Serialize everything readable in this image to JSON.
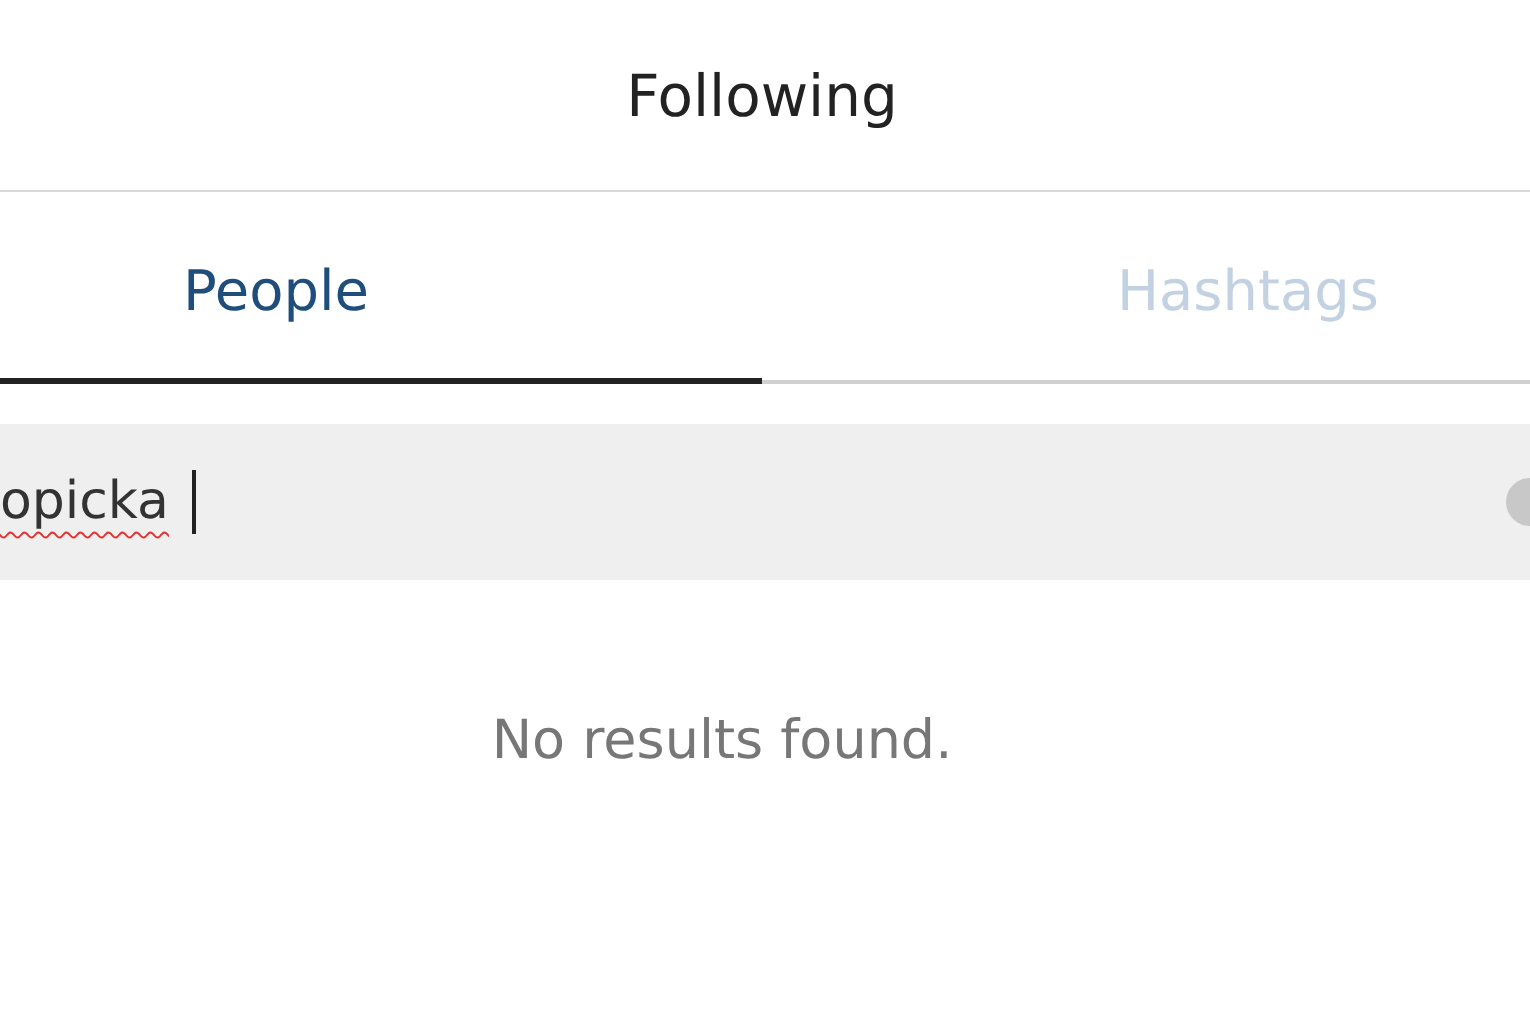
{
  "header": {
    "title": "Following"
  },
  "tabs": [
    {
      "label": "People",
      "selected": true
    },
    {
      "label": "Hashtags",
      "selected": false
    }
  ],
  "search": {
    "value": "opicka",
    "misspelled": true
  },
  "empty_message": "No results found."
}
